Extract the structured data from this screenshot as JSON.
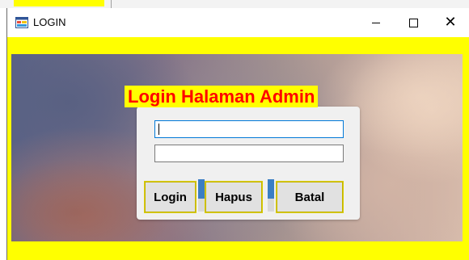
{
  "window": {
    "title": "LOGIN",
    "icon": "winforms-app-icon",
    "controls": {
      "minimize": "minimize-icon",
      "maximize": "maximize-icon",
      "close": "close-icon",
      "close_glyph": "✕"
    }
  },
  "form": {
    "heading": "Login Halaman Admin",
    "username": {
      "value": "",
      "placeholder": ""
    },
    "password": {
      "value": "",
      "placeholder": ""
    },
    "buttons": {
      "login": "Login",
      "hapus": "Hapus",
      "batal": "Batal"
    }
  },
  "colors": {
    "form_background": "#ffff00",
    "heading_text": "#ff0000",
    "heading_background": "#ffff00",
    "focus_border": "#0078d7",
    "separator_accent": "#3a7ec4"
  }
}
